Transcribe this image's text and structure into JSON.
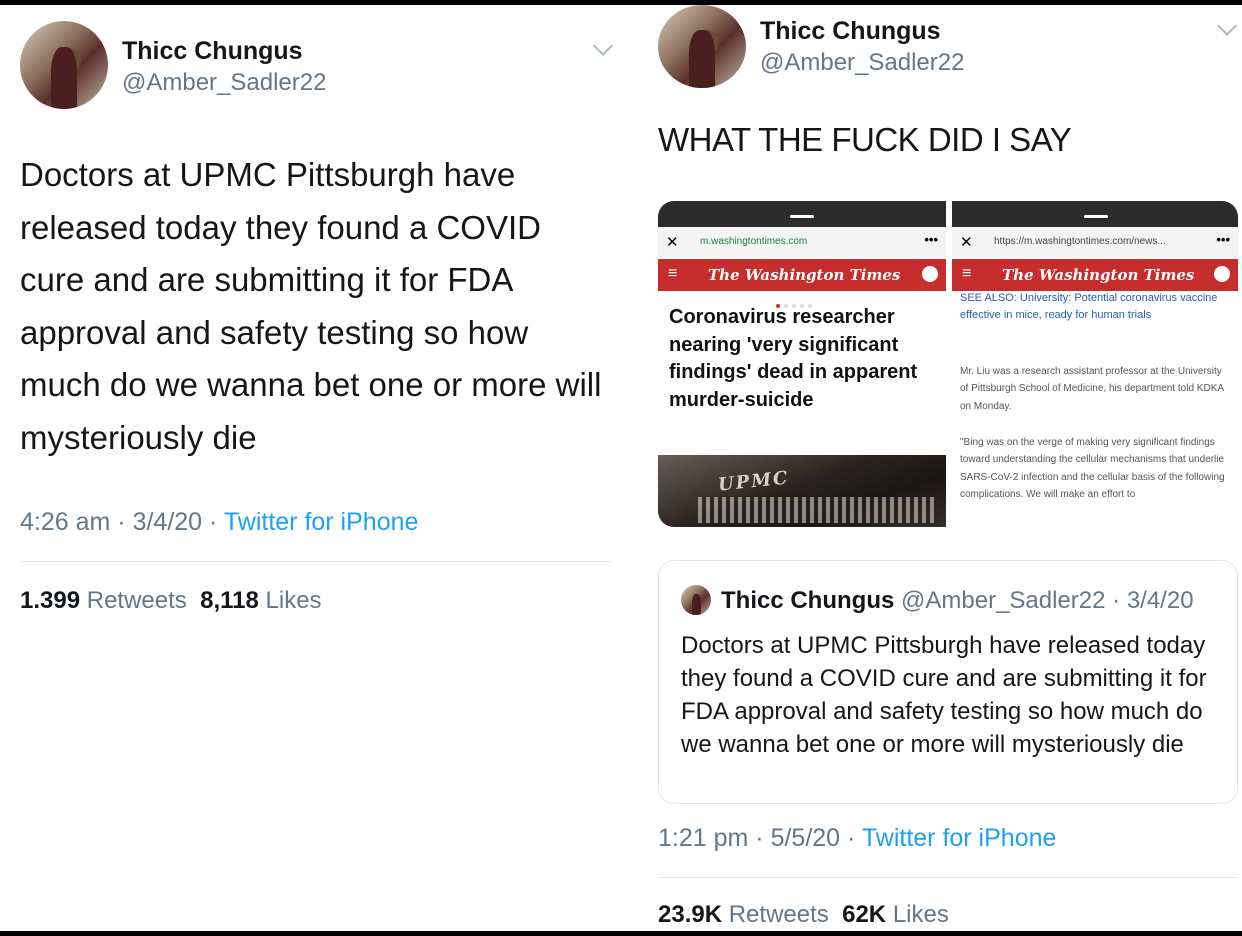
{
  "left_tweet": {
    "display_name": "Thicc Chungus",
    "handle": "@Amber_Sadler22",
    "text": "Doctors at UPMC Pittsburgh have released today they found a COVID cure and are submitting it for FDA approval and safety testing so how much do we wanna bet one or more will mysteriously die",
    "time": "4:26 am",
    "date": "3/4/20",
    "source": "Twitter for iPhone",
    "retweets_count": "1.399",
    "retweets_label": "Retweets",
    "likes_count": "8,118",
    "likes_label": "Likes"
  },
  "right_tweet": {
    "display_name": "Thicc Chungus",
    "handle": "@Amber_Sadler22",
    "text": "WHAT THE FUCK DID I SAY",
    "time": "1:21 pm",
    "date": "5/5/20",
    "source": "Twitter for iPhone",
    "retweets_count": "23.9K",
    "retweets_label": "Retweets",
    "likes_count": "62K",
    "likes_label": "Likes",
    "media": {
      "screenshot_1": {
        "url": "m.washingtontimes.com",
        "masthead": "The Washington Times",
        "headline": "Coronavirus researcher nearing 'very significant findings' dead in apparent murder-suicide",
        "image_text": "UPMC"
      },
      "screenshot_2": {
        "url": "https://m.washingtontimes.com/news...",
        "masthead": "The Washington Times",
        "see_also": "SEE ALSO: University: Potential coronavirus vaccine effective in mice, ready for human trials",
        "paragraph_1": "Mr. Liu was a research assistant professor at the University of Pittsburgh School of Medicine, his department told KDKA on Monday.",
        "paragraph_2": "\"Bing was on the verge of making very significant findings toward understanding the cellular mechanisms that underlie SARS-CoV-2 infection and the cellular basis of the following complications. We will make an effort to"
      }
    },
    "quoted": {
      "display_name": "Thicc Chungus",
      "handle_date": "@Amber_Sadler22 · 3/4/20",
      "text": "Doctors at UPMC Pittsburgh have released today they found a COVID cure and are submitting it for FDA approval and safety testing so how much do we wanna bet one or more will mysteriously die"
    }
  },
  "separator": "·",
  "icons": {
    "chevron": "chevron-down-icon",
    "close": "close-icon",
    "menu": "hamburger-menu-icon",
    "user": "user-icon",
    "more": "more-dots-icon"
  },
  "colors": {
    "link_blue": "#1da1f2",
    "secondary_gray": "#657786",
    "washington_times_red": "#c62e2e"
  }
}
